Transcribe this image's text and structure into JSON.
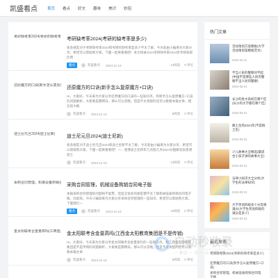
{
  "site": {
    "brand": "凯盛看点"
  },
  "nav": [
    "首页",
    "看点",
    "好文",
    "趣味",
    "美识",
    "妙招"
  ],
  "articles": [
    {
      "thumb_alt": "考研缺考率2024(考研的缺考率是多少)",
      "title": "考研缺考率2024(考研的缺考率是多少)",
      "desc": "很多朋友对于考研缺考率2024和考研的缺考率是多少不太了解，今天就由小编来为大家分享，希望可以帮助到大家，下面一起来看看吧！本文目录2024考研缺考率2024年考研发取比例",
      "tag": "看点",
      "author": "凯盛看点",
      "date": "2024-11-13",
      "views": "13阅读",
      "comments": "0 评论"
    },
    {
      "thumb_alt": "还原魔方的口诀(新手怎么复原魔方+口诀)",
      "title": "还原魔方的口诀(新手怎么复原魔方+口诀)",
      "desc": "Hi，大家好，今天来为大家分享还原魔方的口诀的一些知识点，和新手怎么复原魔方+口诀的问题解析，大家要是都明白，那么可以忽略，但是不太清楚的话可以看看本篇文章，相信很大概",
      "tag": "",
      "author": "凯盛看点",
      "date": "2024-11-13",
      "views": "8阅读",
      "comments": "0 评论"
    },
    {
      "thumb_alt": "迪士尼元旦2024(迪士尼新)",
      "title": "迪士尼元旦2024(迪士尼新)",
      "desc": "很多朋友对于迪士尼元旦2024和迪士尼新不太了解，今天就由小编来为大家分享，希望可以帮助到大家，下面一起来看看吧！一、香港迪士尼跨年几点放几点2024对图解答案香港迪士",
      "tag": "",
      "author": "凯盛看点",
      "date": "2024-11-13",
      "views": "13阅读",
      "comments": "0 评论"
    },
    {
      "thumb_alt": "采购合同管理，机械设备购销合同",
      "title": "采购合同管理，机械设备购销合同电子版",
      "desc": "本篇采购合同管理的问题将不复赘，但是又很多的朋友都不太了解机械设备购销合同电子版，因此呢，今天小编就来为大家分享采购合同管理的一些知识，希望可以帮助到大家，下面我们一",
      "tag": "看点",
      "author": "凯盛看点",
      "date": "2024-11-13",
      "views": "15阅读",
      "comments": "0 评论"
    },
    {
      "thumb_alt": "金太阳联考合金量高吗(江西金太阳教育集团是不是传销)",
      "title": "金太阳联考含金量高吗(江西金太阳教育集团是不是传销)",
      "desc": "Hi，大家好，今天来为大家分享金太阳联考含金量高吗的一些知识点，和江西金太阳教育集团是不是传销的问题解析，大家要是都明白，那么可以忽略，但是不太清楚的话可以看看本篇文章",
      "tag": "",
      "author": "凯盛看点",
      "date": "2024-11-13",
      "views": "9阅读",
      "comments": "0 评论"
    }
  ],
  "sidebar": {
    "hot_title": "热门文章",
    "hot": [
      {
        "text": "活动策划方案模板(大学活动策划案模板范文)",
        "date": "2024-04-11"
      },
      {
        "text": "不当人民的警察对不起(中国不是哪些人民的警察不当人民的警察)",
        "date": "2024-03-31"
      },
      {
        "text": "长沙的各大高校在哪个区(长沙的大学都在哪个区)",
        "date": "2024-03-31"
      },
      {
        "text": "路土生肉2024年(不是鲜土生)",
        "date": "2024-03-31"
      },
      {
        "text": "少儿故事大全精选(最适合小孩子讲的故事大全)",
        "date": "2024-03-31"
      },
      {
        "text": "法律小知识大全分析(大学生的法律知识)",
        "date": "2024-03-31"
      },
      {
        "text": "大学英语四级多少分及格满分(大学生英语四级的满分是多少)",
        "date": "2024-03-31"
      }
    ],
    "recent_title": "最近发表",
    "recent": [
      "考研缺考率2024(考研的缺考率是多少)",
      "还原魔方的口诀(新手怎么复原魔方+口诀)",
      "采购合同管理，机械设备购销合同电子版"
    ]
  },
  "watermark": {
    "text": "自动秒收录",
    "sub": "一 来访 一 次 一 自 动 收 录 一"
  },
  "colors": {
    "accent": "#2196f3",
    "nav_active": "#1e88e5"
  }
}
